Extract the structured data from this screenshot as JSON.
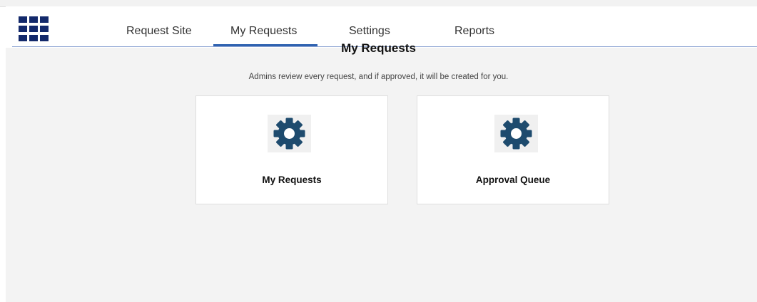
{
  "nav": {
    "launcher_icon": "app-launcher-grid-icon",
    "tabs": [
      {
        "label": "Request Site"
      },
      {
        "label": "My Requests",
        "active": true
      },
      {
        "label": "Settings"
      },
      {
        "label": "Reports"
      }
    ]
  },
  "main": {
    "title": "My Requests",
    "subtitle": "Admins review every request, and if approved, it will be created for you.",
    "cards": [
      {
        "label": "My Requests",
        "icon": "gear-icon"
      },
      {
        "label": "Approval Queue",
        "icon": "gear-icon"
      }
    ]
  },
  "colors": {
    "launcher": "#13296b",
    "active_tab_underline": "#2f62b0",
    "gear": "#1e4b6e",
    "background": "#f3f3f3"
  }
}
